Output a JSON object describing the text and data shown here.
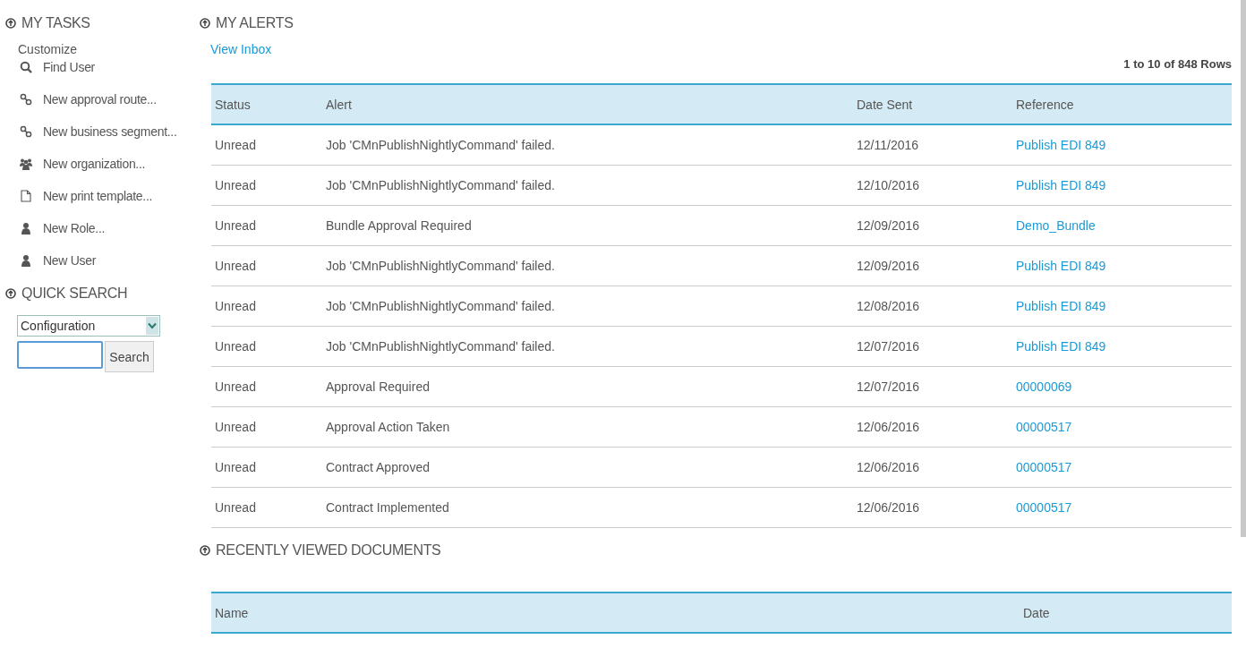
{
  "sidebar": {
    "tasks": {
      "title": "MY TASKS",
      "customize": "Customize",
      "items": [
        {
          "kind": "search",
          "label": "Find User"
        },
        {
          "kind": "link",
          "label": "New approval route..."
        },
        {
          "kind": "link",
          "label": "New business segment..."
        },
        {
          "kind": "group",
          "label": "New organization..."
        },
        {
          "kind": "document",
          "label": "New print template..."
        },
        {
          "kind": "person",
          "label": "New Role..."
        },
        {
          "kind": "person",
          "label": "New User"
        }
      ]
    },
    "quick_search": {
      "title": "QUICK SEARCH",
      "category": "Configuration",
      "button": "Search"
    }
  },
  "alerts": {
    "title": "MY ALERTS",
    "view_inbox": "View Inbox",
    "row_count": "1 to 10 of 848 Rows",
    "columns": [
      "Status",
      "Alert",
      "Date Sent",
      "Reference"
    ],
    "rows": [
      [
        "Unread",
        "Job 'CMnPublishNightlyCommand' failed.",
        "12/11/2016",
        "Publish EDI 849"
      ],
      [
        "Unread",
        "Job 'CMnPublishNightlyCommand' failed.",
        "12/10/2016",
        "Publish EDI 849"
      ],
      [
        "Unread",
        "Bundle Approval Required",
        "12/09/2016",
        "Demo_Bundle"
      ],
      [
        "Unread",
        "Job 'CMnPublishNightlyCommand' failed.",
        "12/09/2016",
        "Publish EDI 849"
      ],
      [
        "Unread",
        "Job 'CMnPublishNightlyCommand' failed.",
        "12/08/2016",
        "Publish EDI 849"
      ],
      [
        "Unread",
        "Job 'CMnPublishNightlyCommand' failed.",
        "12/07/2016",
        "Publish EDI 849"
      ],
      [
        "Unread",
        "Approval Required",
        "12/07/2016",
        "00000069"
      ],
      [
        "Unread",
        "Approval Action Taken",
        "12/06/2016",
        "00000517"
      ],
      [
        "Unread",
        "Contract Approved",
        "12/06/2016",
        "00000517"
      ],
      [
        "Unread",
        "Contract Implemented",
        "12/06/2016",
        "00000517"
      ]
    ]
  },
  "recent": {
    "title": "RECENTLY VIEWED DOCUMENTS",
    "columns": [
      "Name",
      "Date"
    ]
  }
}
